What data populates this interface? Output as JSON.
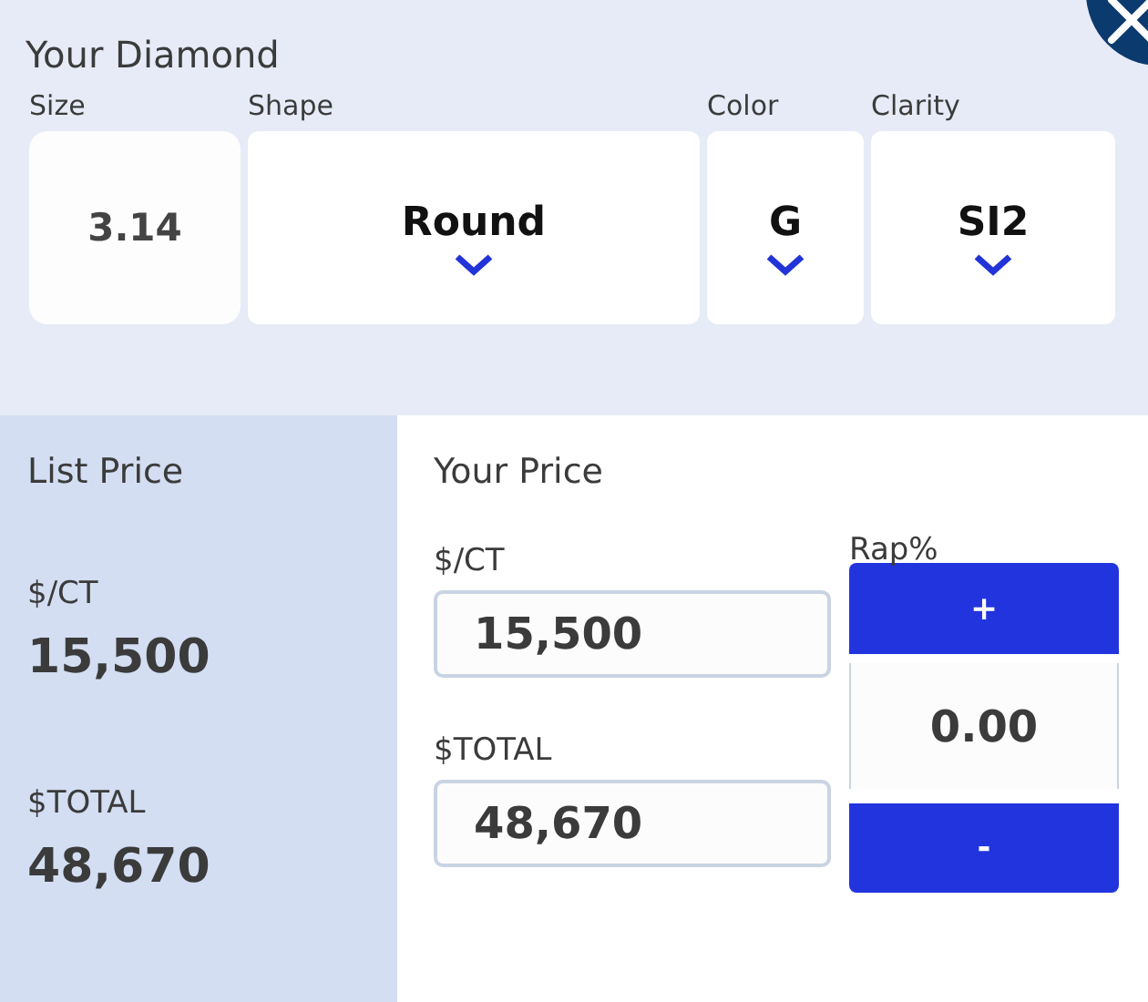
{
  "diamond": {
    "title": "Your Diamond",
    "fields": [
      {
        "label": "Size",
        "value": "3.14",
        "kind": "input"
      },
      {
        "label": "Shape",
        "value": "Round",
        "kind": "select"
      },
      {
        "label": "Color",
        "value": "G",
        "kind": "select"
      },
      {
        "label": "Clarity",
        "value": "SI2",
        "kind": "select"
      }
    ]
  },
  "list_price": {
    "title": "List Price",
    "per_ct_label": "$/CT",
    "per_ct": "15,500",
    "total_label": "$TOTAL",
    "total": "48,670"
  },
  "your_price": {
    "title": "Your Price",
    "per_ct_label": "$/CT",
    "per_ct": "15,500",
    "total_label": "$TOTAL",
    "total": "48,670",
    "rap_label": "Rap%",
    "plus": "+",
    "rap": "0.00",
    "minus": "-"
  }
}
